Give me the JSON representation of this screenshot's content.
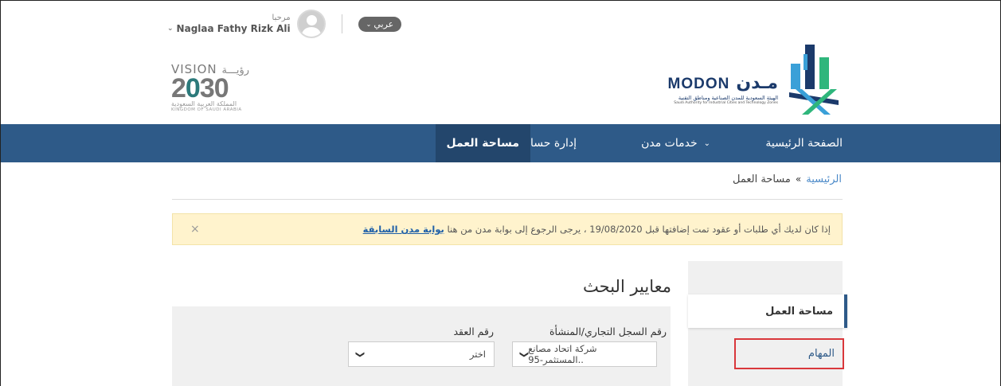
{
  "user": {
    "greeting": "مرحبا",
    "name": "Naglaa Fathy Rizk Ali",
    "language_button": "عربي"
  },
  "vision": {
    "top_en": "VISION",
    "top_ar": "رؤيـــة",
    "num_a": "2",
    "num_b": "0",
    "num_c": "30",
    "sub_ar": "المملكة العربية السعودية",
    "sub_en": "KINGDOM OF SAUDI ARABIA"
  },
  "modon": {
    "en": "MODON",
    "ar": "مـدن",
    "sub_ar": "الهيئة السعودية للمدن الصناعية ومناطق التقنية",
    "sub_en": "Saudi Authority for Industrial Cities and Technology Zones"
  },
  "nav": {
    "home": "الصفحة الرئيسية",
    "services": "خدمات مدن",
    "accounts": "إدارة حساباتي",
    "workspace": "مساحة العمل"
  },
  "breadcrumb": {
    "home": "الرئيسية",
    "separator": "»",
    "current": "مساحة العمل"
  },
  "alert": {
    "text": "إذا كان لديك أي طلبات أو عقود تمت إضافتها قبل 19/08/2020 ، يرجى الرجوع إلى بوابة مدن من هنا",
    "link": "بوابة مدن السابقة",
    "close": "×"
  },
  "sidebar": {
    "workspace": "مساحة العمل",
    "tasks": "المهام"
  },
  "search": {
    "title": "معايير البحث",
    "cr_label": "رقم السجل التجاري/المنشأة",
    "cr_value": "شركة اتحاد مصانع المستثمر-95..",
    "contract_label": "رقم العقد",
    "contract_value": "اختر"
  },
  "colors": {
    "nav": "#2e5a88",
    "nav_active": "#23466c",
    "alert_bg": "#fff3cd",
    "highlight": "#d9373b"
  }
}
